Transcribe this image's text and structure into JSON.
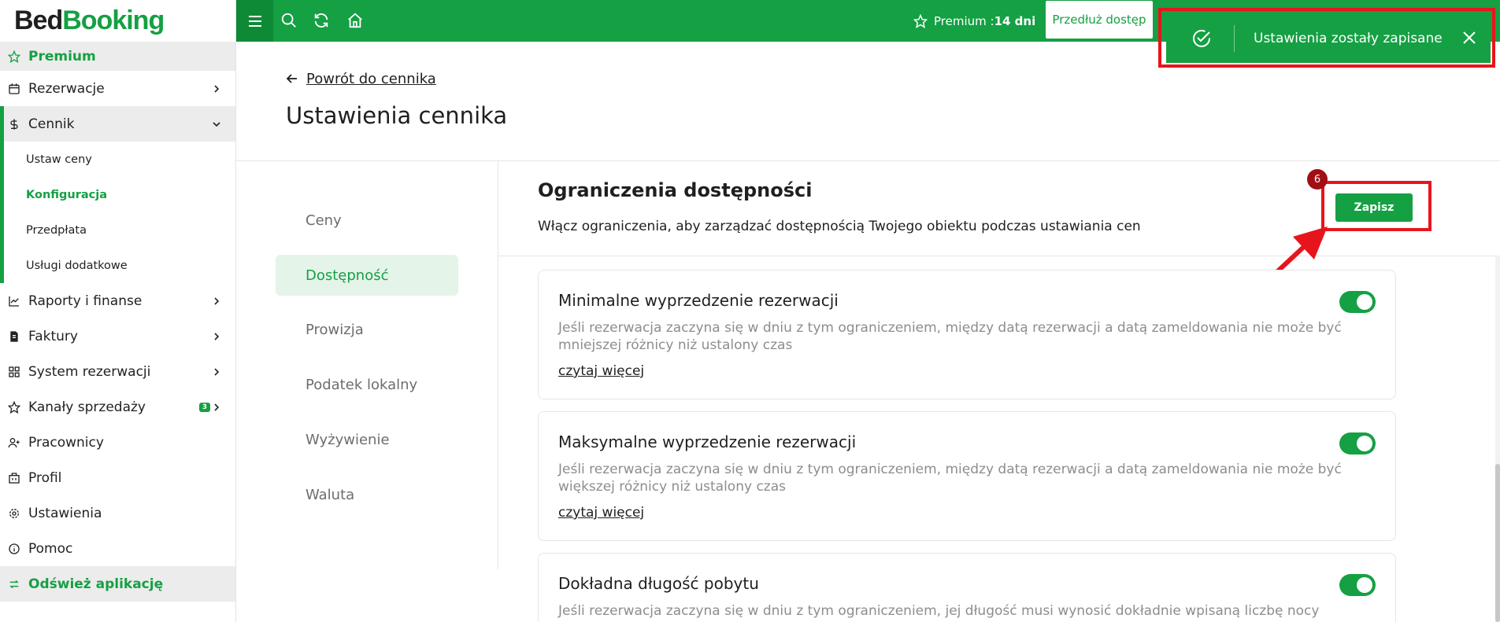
{
  "brand": {
    "logo_bed": "Bed",
    "logo_booking": "Booking"
  },
  "colors": {
    "brand_green": "#15a043",
    "annotation_red": "#e8141c"
  },
  "sidebar": {
    "premium": "Premium",
    "reservations": "Rezerwacje",
    "pricing": "Cennik",
    "pricing_sub": {
      "set_prices": "Ustaw ceny",
      "configuration": "Konfiguracja",
      "prepayment": "Przedpłata",
      "extra_services": "Usługi dodatkowe"
    },
    "reports": "Raporty i finanse",
    "invoices": "Faktury",
    "booking_system": "System rezerwacji",
    "sales_channels": "Kanały sprzedaży",
    "sales_channels_badge": "3",
    "employees": "Pracownicy",
    "profile": "Profil",
    "settings": "Ustawienia",
    "help": "Pomoc",
    "refresh_app": "Odśwież aplikację"
  },
  "topbar": {
    "premium_label": "Premium : ",
    "premium_days": "14 dni",
    "extend_button": "Przedłuż dostęp"
  },
  "toast": {
    "message": "Ustawienia zostały zapisane"
  },
  "page": {
    "back_link": "Powrót do cennika",
    "title": "Ustawienia cennika"
  },
  "tabs": [
    "Ceny",
    "Dostępność",
    "Prowizja",
    "Podatek lokalny",
    "Wyżywienie",
    "Waluta"
  ],
  "section": {
    "title": "Ograniczenia dostępności",
    "description": "Włącz ograniczenia, aby zarządzać dostępnością Twojego obiektu podczas ustawiania cen",
    "save_button": "Zapisz",
    "step_marker": "6"
  },
  "cards": [
    {
      "title": "Minimalne wyprzedzenie rezerwacji",
      "description": "Jeśli rezerwacja zaczyna się w dniu z tym ograniczeniem, między datą rezerwacji a datą zameldowania nie może być mniejszej różnicy niż ustalony czas",
      "link": "czytaj więcej",
      "enabled": true
    },
    {
      "title": "Maksymalne wyprzedzenie rezerwacji",
      "description": "Jeśli rezerwacja zaczyna się w dniu z tym ograniczeniem, między datą rezerwacji a datą zameldowania nie może być większej różnicy niż ustalony czas",
      "link": "czytaj więcej",
      "enabled": true
    },
    {
      "title": "Dokładna długość pobytu",
      "description": "Jeśli rezerwacja zaczyna się w dniu z tym ograniczeniem, jej długość musi wynosić dokładnie wpisaną liczbę nocy",
      "enabled": true
    }
  ]
}
